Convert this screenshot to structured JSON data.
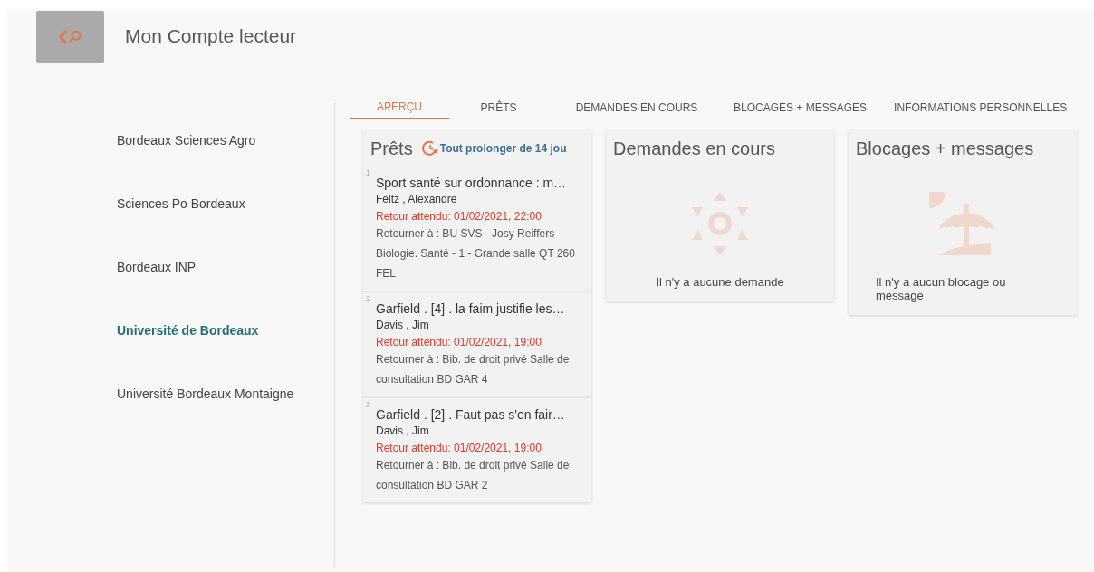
{
  "header": {
    "title": "Mon Compte lecteur"
  },
  "sidebar": {
    "items": [
      {
        "label": "Bordeaux Sciences Agro",
        "selected": false
      },
      {
        "label": "Sciences Po Bordeaux",
        "selected": false
      },
      {
        "label": "Bordeaux INP",
        "selected": false
      },
      {
        "label": "Université de Bordeaux",
        "selected": true
      },
      {
        "label": "Université Bordeaux Montaigne",
        "selected": false
      }
    ]
  },
  "tabs": [
    {
      "label": "APERÇU",
      "selected": true
    },
    {
      "label": "PRÊTS",
      "selected": false
    },
    {
      "label": "DEMANDES EN COURS",
      "selected": false
    },
    {
      "label": "BLOCAGES + MESSAGES",
      "selected": false
    },
    {
      "label": "INFORMATIONS PERSONNELLES",
      "selected": false
    }
  ],
  "loans": {
    "title": "Prêts",
    "renew_link": "Tout prolonger de 14 jou",
    "items": [
      {
        "number": "1",
        "title": "Sport santé sur ordonnance : m…",
        "author": "Feltz , Alexandre",
        "due": "Retour attendu: 01/02/2021, 22:00",
        "return_to": "Retourner à : BU SVS - Josy Reiffers Biologie. Santé - 1 - Grande salle QT 260 FEL"
      },
      {
        "number": "2",
        "title": "Garfield . [4] . la faim justifie les…",
        "author": "Davis , Jim",
        "due": "Retour attendu: 01/02/2021, 19:00",
        "return_to": "Retourner à : Bib. de droit privé Salle de consultation BD GAR 4"
      },
      {
        "number": "3",
        "title": "Garfield . [2] . Faut pas s'en fair…",
        "author": "Davis , Jim",
        "due": "Retour attendu: 01/02/2021, 19:00",
        "return_to": "Retourner à : Bib. de droit privé Salle de consultation BD GAR 2"
      }
    ]
  },
  "panels": [
    {
      "kind": "requests",
      "title": "Demandes en cours",
      "message": "Il n'y a aucune demande"
    },
    {
      "kind": "blocks",
      "title": "Blocages + messages",
      "message": "Il n'y a aucun blocage ou message"
    }
  ]
}
